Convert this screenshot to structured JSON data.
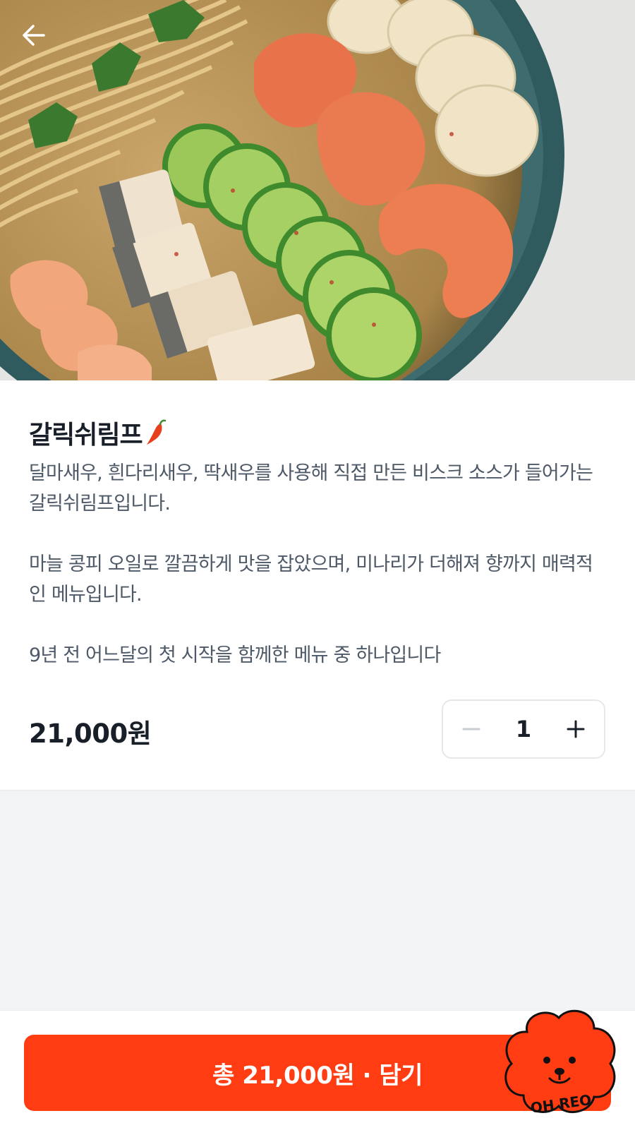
{
  "header": {
    "back_icon": "arrow-left-icon"
  },
  "hero_image": {
    "subject": "food-photo"
  },
  "menu": {
    "name": "갈릭쉬림프",
    "spicy_icon": "chili-pepper-icon",
    "description": [
      "달마새우, 흰다리새우, 딱새우를 사용해 직접 만든 비스크 소스가 들어가는 갈릭쉬림프입니다.",
      "마늘 콩피 오일로 깔끔하게 맛을 잡았으며, 미나리가 더해져 향까지 매력적인 메뉴입니다.",
      "9년 전 어느달의 첫 시작을 함께한 메뉴 중 하나입니다"
    ],
    "price": "21,000원"
  },
  "quantity": {
    "value": "1",
    "minus_icon": "minus-icon",
    "plus_icon": "plus-icon"
  },
  "cta": {
    "label": "총 21,000원 · 담기"
  },
  "mascot": {
    "label": "OH REO",
    "icon": "dog-mascot-icon"
  },
  "colors": {
    "accent": "#ff3c12",
    "text_primary": "#191f28",
    "text_secondary": "#4e5968",
    "background": "#f2f4f6"
  }
}
